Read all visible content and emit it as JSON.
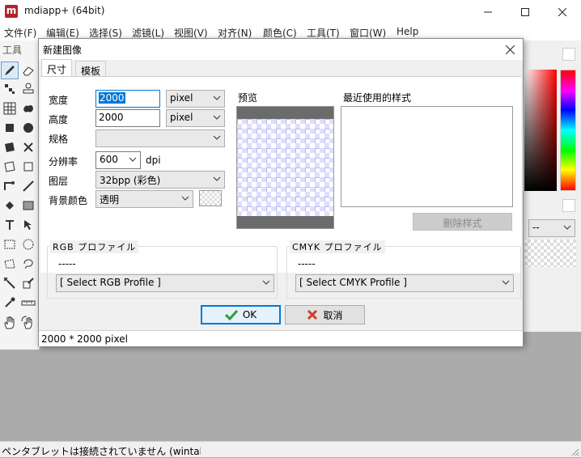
{
  "app": {
    "logo": "m",
    "title": "mdiapp+ (64bit)"
  },
  "menu": [
    "文件(F)",
    "编辑(E)",
    "选择(S)",
    "滤镜(L)",
    "视图(V)",
    "对齐(N)",
    "颜色(C)",
    "工具(T)",
    "窗口(W)",
    "Help"
  ],
  "tool_panel": {
    "title": "工具",
    "tools": [
      "pencil-tool",
      "eraser-tool",
      "dot-tool",
      "stamp-tool",
      "grid-tool",
      "blob-tool",
      "square-fill-tool",
      "circle-fill-tool",
      "shape-fill-tool",
      "brush-cross-tool",
      "square-outline-tool",
      "rect-outline-tool",
      "pen-tool",
      "line-tool",
      "fill-tool",
      "gradient-tool",
      "text-tool",
      "move-tool",
      "rect-select-tool",
      "ellipse-select-tool",
      "lasso-tool",
      "polygon-lasso-tool",
      "magic-wand-tool",
      "transform-tool",
      "eyedropper-tool",
      "ruler-tool",
      "hand-tool",
      "rotate-hand-tool"
    ]
  },
  "status_bar": {
    "text": "ペンタブレットは接続されていません (wintab"
  },
  "layer_panel": {
    "blend_mode": "--"
  },
  "dialog": {
    "title": "新建图像",
    "tabs": [
      "尺寸",
      "模板"
    ],
    "width": {
      "label": "宽度",
      "value": "2000",
      "unit": "pixel"
    },
    "height": {
      "label": "高度",
      "value": "2000",
      "unit": "pixel"
    },
    "size_preset": {
      "label": "规格",
      "value": ""
    },
    "resolution": {
      "label": "分辨率",
      "value": "600",
      "unit": "dpi"
    },
    "layer": {
      "label": "图层",
      "value": "32bpp (彩色)"
    },
    "background": {
      "label": "背景颜色",
      "value": "透明"
    },
    "preview_label": "预览",
    "recent_label": "最近使用的样式",
    "delete_style": "删除样式",
    "rgb_profile": {
      "title": "RGB プロファイル",
      "name": "-----",
      "select": "[ Select RGB Profile ]"
    },
    "cmyk_profile": {
      "title": "CMYK プロファイル",
      "name": "-----",
      "select": "[ Select CMYK Profile ]"
    },
    "ok": "OK",
    "cancel": "取消",
    "status": "2000 * 2000 pixel"
  },
  "colors": {
    "accent": "#0078d7",
    "ok_check": "#2e9d3c",
    "cancel_x": "#d33b2c",
    "logo": "#b5222b"
  }
}
